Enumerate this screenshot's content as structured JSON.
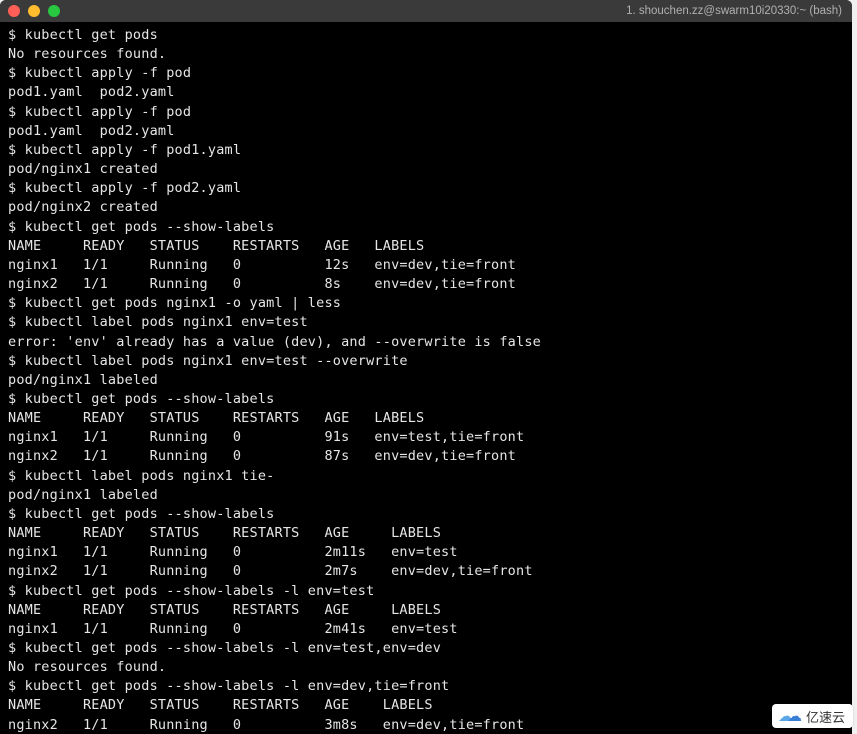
{
  "window": {
    "title": "1. shouchen.zz@swarm10i20330:~ (bash)"
  },
  "terminal": {
    "lines": [
      "$ kubectl get pods",
      "No resources found.",
      "$ kubectl apply -f pod",
      "pod1.yaml  pod2.yaml",
      "$ kubectl apply -f pod",
      "pod1.yaml  pod2.yaml",
      "$ kubectl apply -f pod1.yaml",
      "pod/nginx1 created",
      "$ kubectl apply -f pod2.yaml",
      "pod/nginx2 created",
      "$ kubectl get pods --show-labels",
      "NAME     READY   STATUS    RESTARTS   AGE   LABELS",
      "nginx1   1/1     Running   0          12s   env=dev,tie=front",
      "nginx2   1/1     Running   0          8s    env=dev,tie=front",
      "$ kubectl get pods nginx1 -o yaml | less",
      "$ kubectl label pods nginx1 env=test",
      "error: 'env' already has a value (dev), and --overwrite is false",
      "$ kubectl label pods nginx1 env=test --overwrite",
      "pod/nginx1 labeled",
      "$ kubectl get pods --show-labels",
      "NAME     READY   STATUS    RESTARTS   AGE   LABELS",
      "nginx1   1/1     Running   0          91s   env=test,tie=front",
      "nginx2   1/1     Running   0          87s   env=dev,tie=front",
      "$ kubectl label pods nginx1 tie-",
      "pod/nginx1 labeled",
      "$ kubectl get pods --show-labels",
      "NAME     READY   STATUS    RESTARTS   AGE     LABELS",
      "nginx1   1/1     Running   0          2m11s   env=test",
      "nginx2   1/1     Running   0          2m7s    env=dev,tie=front",
      "$ kubectl get pods --show-labels -l env=test",
      "NAME     READY   STATUS    RESTARTS   AGE     LABELS",
      "nginx1   1/1     Running   0          2m41s   env=test",
      "$ kubectl get pods --show-labels -l env=test,env=dev",
      "No resources found.",
      "$ kubectl get pods --show-labels -l env=dev,tie=front",
      "NAME     READY   STATUS    RESTARTS   AGE    LABELS",
      "nginx2   1/1     Running   0          3m8s   env=dev,tie=front"
    ]
  },
  "watermark": {
    "text": "亿速云"
  }
}
